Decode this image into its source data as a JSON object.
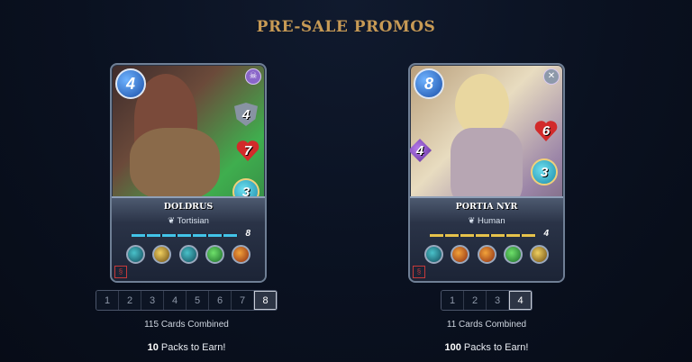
{
  "page_title": "PRE-SALE PROMOS",
  "promos": [
    {
      "card": {
        "name": "DOLDRUS",
        "type": "Tortisian",
        "mana": "4",
        "armor": "4",
        "health": "7",
        "speed": "3",
        "level": "8",
        "bar_color": "#42c4e8"
      },
      "levels": [
        "1",
        "2",
        "3",
        "4",
        "5",
        "6",
        "7",
        "8"
      ],
      "selected_level": "8",
      "cards_combined": "115 Cards Combined",
      "packs_count": "10",
      "packs_suffix": " Packs to Earn!"
    },
    {
      "card": {
        "name": "PORTIA NYR",
        "type": "Human",
        "mana": "8",
        "attack": "4",
        "health": "6",
        "speed": "3",
        "level": "4",
        "bar_color": "#e6c24b"
      },
      "levels": [
        "1",
        "2",
        "3",
        "4"
      ],
      "selected_level": "4",
      "cards_combined": "11 Cards Combined",
      "packs_count": "100",
      "packs_suffix": " Packs to Earn!"
    }
  ]
}
